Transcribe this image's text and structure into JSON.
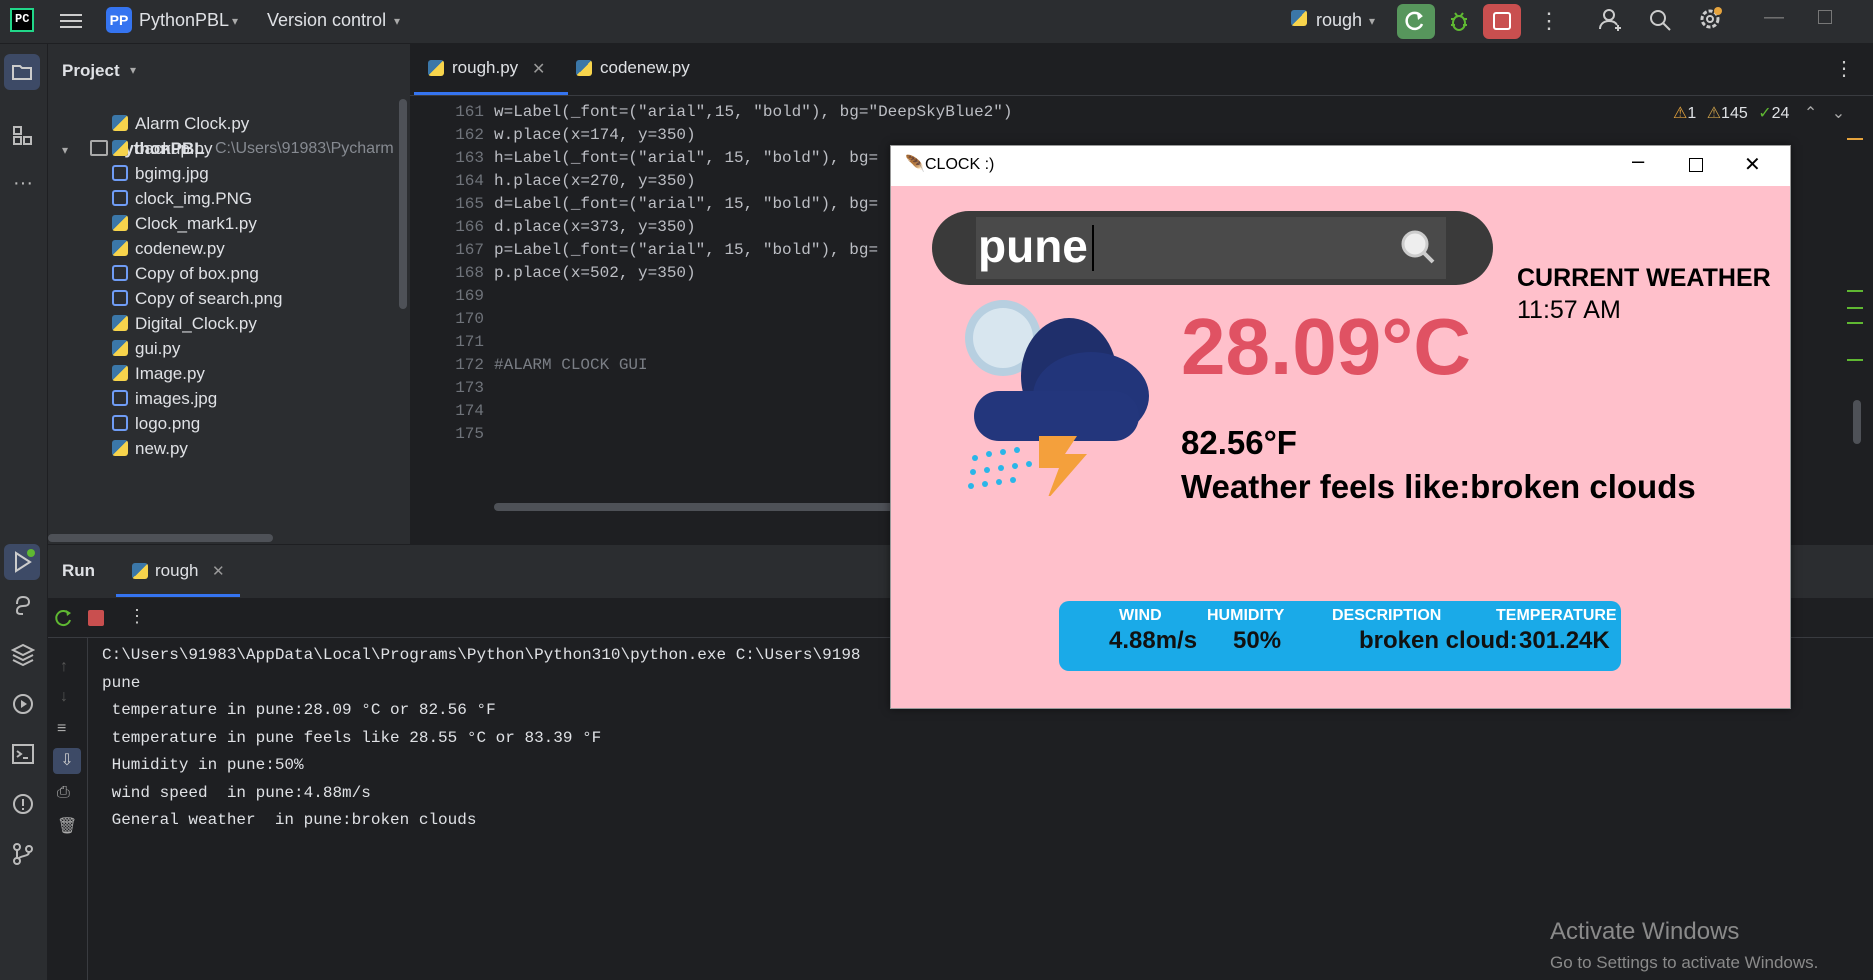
{
  "titlebar": {
    "project_badge": "PP",
    "project_name": "PythonPBL",
    "vcs": "Version control",
    "run_config": "rough"
  },
  "project_panel": {
    "title": "Project",
    "root": {
      "name": "PythonPBL",
      "path": "C:\\Users\\91983\\Pycharm"
    },
    "files": [
      {
        "name": "Alarm  Clock.py",
        "type": "py"
      },
      {
        "name": "backup.py",
        "type": "py"
      },
      {
        "name": "bgimg.jpg",
        "type": "img"
      },
      {
        "name": "clock_img.PNG",
        "type": "img"
      },
      {
        "name": "Clock_mark1.py",
        "type": "py"
      },
      {
        "name": "codenew.py",
        "type": "py"
      },
      {
        "name": "Copy of box.png",
        "type": "img"
      },
      {
        "name": "Copy of search.png",
        "type": "img"
      },
      {
        "name": "Digital_Clock.py",
        "type": "py"
      },
      {
        "name": "gui.py",
        "type": "py"
      },
      {
        "name": "Image.py",
        "type": "py"
      },
      {
        "name": "images.jpg",
        "type": "img"
      },
      {
        "name": "logo.png",
        "type": "img"
      },
      {
        "name": "new.py",
        "type": "py"
      }
    ]
  },
  "editor": {
    "tabs": [
      "rough.py",
      "codenew.py"
    ],
    "inspections": {
      "warn1": "1",
      "warn2": "145",
      "ok": "24"
    },
    "lines": [
      {
        "n": "161",
        "text": "w=Label(_font=(\"arial\",15, \"bold\"), bg=\"DeepSkyBlue2\")"
      },
      {
        "n": "162",
        "text": "w.place(x=174, y=350)"
      },
      {
        "n": "163",
        "text": "h=Label(_font=(\"arial\", 15, \"bold\"), bg="
      },
      {
        "n": "164",
        "text": "h.place(x=270, y=350)"
      },
      {
        "n": "165",
        "text": "d=Label(_font=(\"arial\", 15, \"bold\"), bg="
      },
      {
        "n": "166",
        "text": "d.place(x=373, y=350)"
      },
      {
        "n": "167",
        "text": "p=Label(_font=(\"arial\", 15, \"bold\"), bg="
      },
      {
        "n": "168",
        "text": "p.place(x=502, y=350)"
      },
      {
        "n": "169",
        "text": ""
      },
      {
        "n": "170",
        "text": ""
      },
      {
        "n": "171",
        "text": ""
      },
      {
        "n": "172",
        "text": "#ALARM CLOCK GUI"
      },
      {
        "n": "173",
        "text": ""
      },
      {
        "n": "174",
        "text": ""
      },
      {
        "n": "175",
        "text": ""
      }
    ]
  },
  "run_panel": {
    "title": "Run",
    "tab": "rough",
    "output": [
      "C:\\Users\\91983\\AppData\\Local\\Programs\\Python\\Python310\\python.exe C:\\Users\\9198",
      "pune",
      " temperature in pune:28.09 °C or 82.56 °F",
      " temperature in pune feels like 28.55 °C or 83.39 °F",
      " Humidity in pune:50%",
      " wind speed  in pune:4.88m/s",
      " General weather  in pune:broken clouds"
    ]
  },
  "clock_window": {
    "title": "CLOCK :)",
    "search_value": "pune",
    "heading": "CURRENT WEATHER",
    "time": "11:57 AM",
    "temp_c": "28.09°C",
    "temp_f": "82.56°F",
    "feels": "Weather feels like:broken clouds",
    "stats": {
      "wind_label": "WIND",
      "wind_value": "4.88m/s",
      "humidity_label": "HUMIDITY",
      "humidity_value": "50%",
      "description_label": "DESCRIPTION",
      "description_value": "broken cloud:",
      "temperature_label": "TEMPERATURE",
      "temperature_value": "301.24K"
    }
  },
  "watermark": {
    "line1": "Activate Windows",
    "line2": "Go to Settings to activate Windows."
  },
  "colors": {
    "accent_red": "#e05263",
    "stats_blue": "#1aaae8",
    "pink_bg": "#ffc0cb"
  }
}
